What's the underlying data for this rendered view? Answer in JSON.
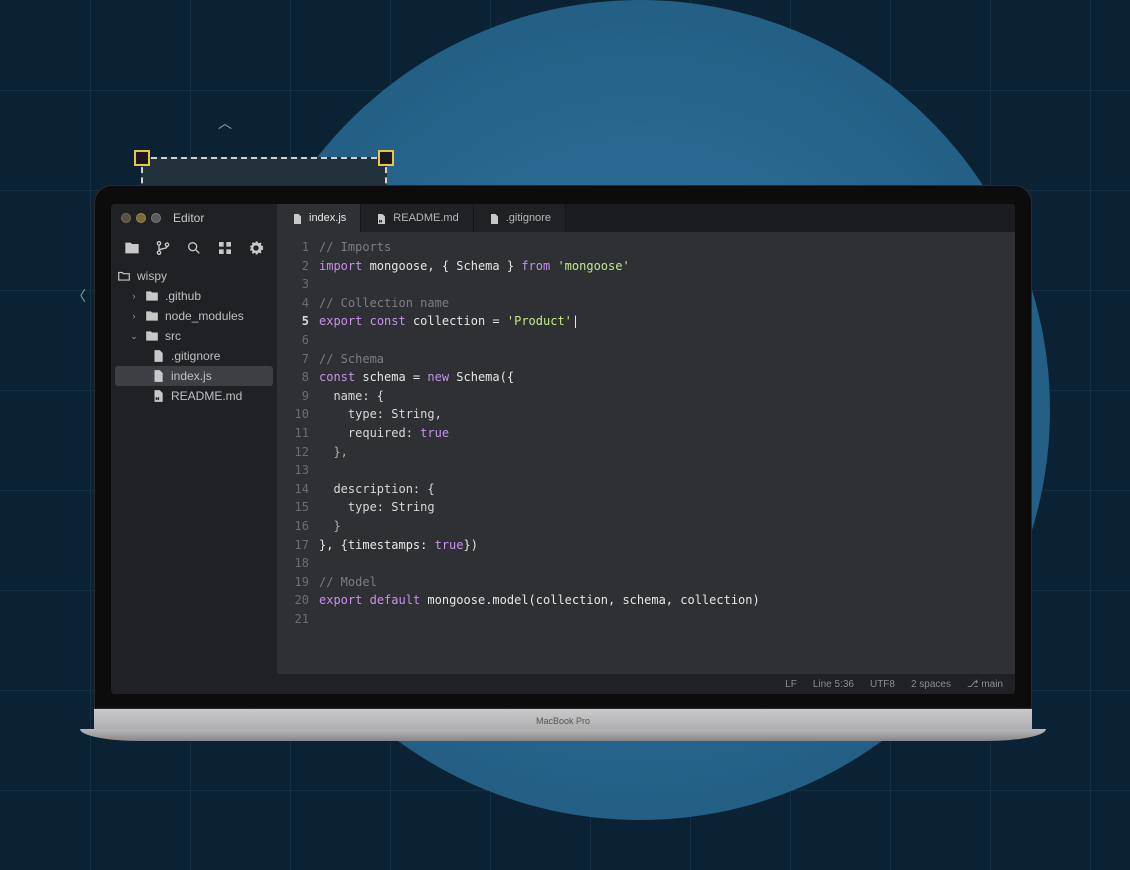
{
  "app": {
    "title": "Editor"
  },
  "laptop": {
    "model": "MacBook Pro"
  },
  "tabs": [
    {
      "label": "index.js",
      "icon": "file-js-icon",
      "active": true
    },
    {
      "label": "README.md",
      "icon": "file-md-icon",
      "active": false
    },
    {
      "label": ".gitignore",
      "icon": "file-icon",
      "active": false
    }
  ],
  "sidebar": {
    "project": "wispy",
    "items": [
      {
        "label": ".github",
        "depth": 1,
        "kind": "folder",
        "expanded": false
      },
      {
        "label": "node_modules",
        "depth": 1,
        "kind": "folder",
        "expanded": false
      },
      {
        "label": "src",
        "depth": 1,
        "kind": "folder",
        "expanded": true
      },
      {
        "label": ".gitignore",
        "depth": 2,
        "kind": "file",
        "selected": false
      },
      {
        "label": "index.js",
        "depth": 2,
        "kind": "file",
        "selected": true
      },
      {
        "label": "README.md",
        "depth": 2,
        "kind": "file-md",
        "selected": false
      }
    ]
  },
  "code": {
    "current_line": 5,
    "lines": [
      [
        {
          "t": "// Imports",
          "c": "comment"
        }
      ],
      [
        {
          "t": "import",
          "c": "kw"
        },
        {
          "t": " mongoose, { Schema } ",
          "c": "ident"
        },
        {
          "t": "from",
          "c": "kw"
        },
        {
          "t": " ",
          "c": "punc"
        },
        {
          "t": "'mongoose'",
          "c": "str"
        }
      ],
      [],
      [
        {
          "t": "// Collection name",
          "c": "comment"
        }
      ],
      [
        {
          "t": "export",
          "c": "kw"
        },
        {
          "t": " ",
          "c": "punc"
        },
        {
          "t": "const",
          "c": "kw"
        },
        {
          "t": " collection = ",
          "c": "ident"
        },
        {
          "t": "'Product'",
          "c": "str"
        },
        {
          "t": "|",
          "c": "cursor"
        }
      ],
      [],
      [
        {
          "t": "// Schema",
          "c": "comment"
        }
      ],
      [
        {
          "t": "const",
          "c": "kw"
        },
        {
          "t": " schema = ",
          "c": "ident"
        },
        {
          "t": "new",
          "c": "kw"
        },
        {
          "t": " Schema({",
          "c": "ident"
        }
      ],
      [
        {
          "t": "  name: {",
          "c": "prop"
        }
      ],
      [
        {
          "t": "    type: String,",
          "c": "prop"
        }
      ],
      [
        {
          "t": "    required: ",
          "c": "prop"
        },
        {
          "t": "true",
          "c": "kw"
        }
      ],
      [
        {
          "t": "  },",
          "c": "punc"
        }
      ],
      [],
      [
        {
          "t": "  description: {",
          "c": "prop"
        }
      ],
      [
        {
          "t": "    type: String",
          "c": "prop"
        }
      ],
      [
        {
          "t": "  }",
          "c": "punc"
        }
      ],
      [
        {
          "t": "}, {timestamps: ",
          "c": "ident"
        },
        {
          "t": "true",
          "c": "kw"
        },
        {
          "t": "})",
          "c": "ident"
        }
      ],
      [],
      [
        {
          "t": "// Model",
          "c": "comment"
        }
      ],
      [
        {
          "t": "export",
          "c": "kw"
        },
        {
          "t": " ",
          "c": "punc"
        },
        {
          "t": "default",
          "c": "kw"
        },
        {
          "t": " mongoose.model(collection, schema, collection)",
          "c": "ident"
        }
      ],
      []
    ]
  },
  "status": {
    "eol": "LF",
    "position": "Line 5:36",
    "encoding": "UTF8",
    "indent": "2 spaces",
    "branch": "main",
    "branch_glyph": "⎇"
  }
}
